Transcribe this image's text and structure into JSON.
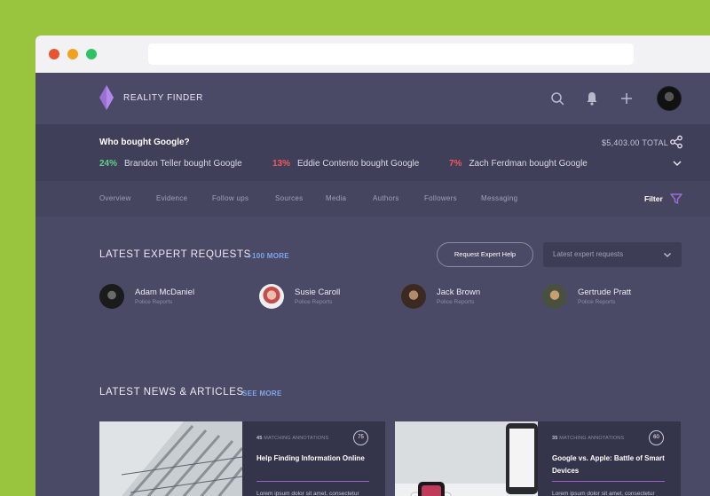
{
  "app": {
    "brand": "REALITY FINDER",
    "colors": {
      "accent": "#9b6fd6",
      "positive": "#5fd08c",
      "negative": "#f05a5a",
      "link": "#7fa6e8"
    }
  },
  "topbar": {
    "icons": [
      "search-icon",
      "bell-icon",
      "plus-icon",
      "user-avatar"
    ]
  },
  "summary": {
    "question": "Who bought Google?",
    "total": "$5,403.00 TOTAL",
    "stats": [
      {
        "pct": "24%",
        "text": "Brandon Teller bought Google",
        "tone": "positive"
      },
      {
        "pct": "13%",
        "text": "Eddie Contento bought Google",
        "tone": "negative"
      },
      {
        "pct": "7%",
        "text": "Zach Ferdman bought Google",
        "tone": "negative"
      }
    ]
  },
  "tabs": {
    "items": [
      "Overview",
      "Evidence",
      "Follow ups",
      "Sources",
      "Media",
      "Authors",
      "Followers",
      "Messaging"
    ],
    "filter_label": "Filter"
  },
  "experts": {
    "title": "LATEST EXPERT REQUESTS",
    "more_label": "+100 MORE",
    "request_button": "Request Expert Help",
    "select_value": "Latest expert requests",
    "people": [
      {
        "name": "Adam McDaniel",
        "role": "Police Reports"
      },
      {
        "name": "Susie Caroll",
        "role": "Police Reports"
      },
      {
        "name": "Jack Brown",
        "role": "Police Reports"
      },
      {
        "name": "Gertrude Pratt",
        "role": "Police Reports"
      }
    ]
  },
  "news": {
    "title": "LATEST NEWS & ARTICLES",
    "more_label": "SEE MORE",
    "cards": [
      {
        "annotations_count": "45",
        "annotations_label": "MATCHING ANNOTATIONS",
        "score": "75",
        "title": "Help Finding Information Online",
        "excerpt": "Lorem ipsum dolor sit amet, consectetur adipiscing elit. Ut pretium pretium tempor, lorem ipsum dolor si."
      },
      {
        "annotations_count": "35",
        "annotations_label": "MATCHING ANNOTATIONS",
        "score": "60",
        "title": "Google vs. Apple: Battle of Smart Devices",
        "excerpt": "Lorem ipsum dolor sit amet, consectetur adipiscing elit. Ut pretium pretium tempor, lorem ipsum dolor si."
      }
    ]
  }
}
